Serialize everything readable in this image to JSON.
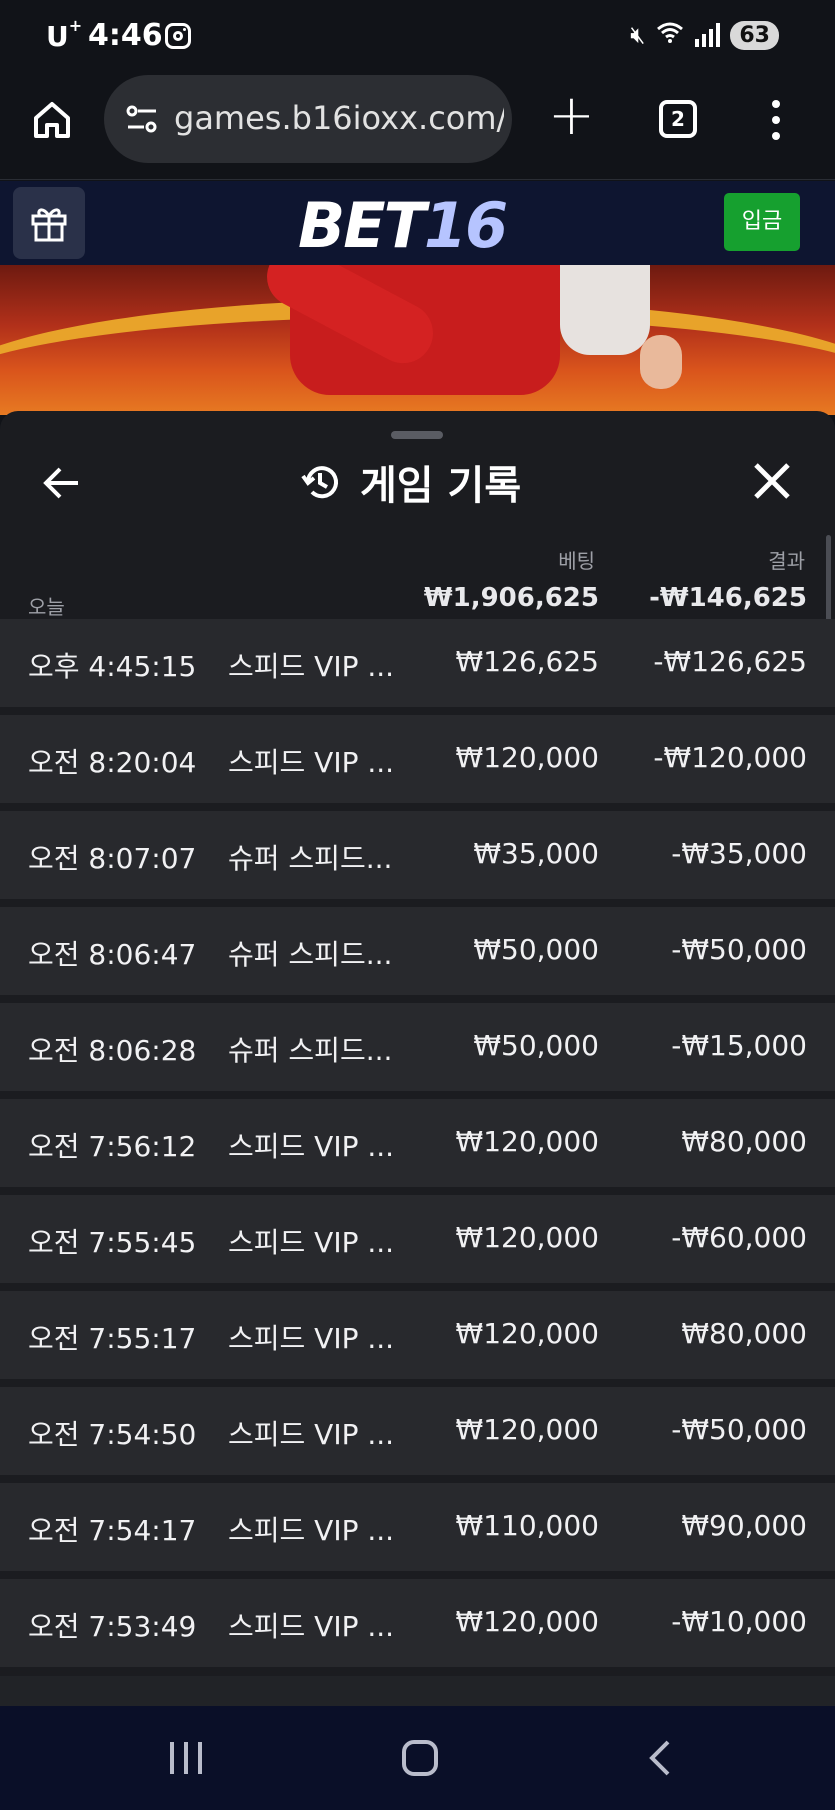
{
  "status_bar": {
    "carrier": "U",
    "carrier_sup": "+",
    "time": "4:46",
    "battery": "63"
  },
  "browser": {
    "url": "games.b16ioxx.com/",
    "tab_count": "2"
  },
  "site": {
    "logo_part1": "BET",
    "logo_part2": "16",
    "deposit_label": "입금"
  },
  "panel": {
    "title": "게임 기록",
    "col_bet": "베팅",
    "col_result": "결과",
    "today_label": "오늘",
    "total_bet": "₩1,906,625",
    "total_result": "-₩146,625"
  },
  "rows": [
    {
      "time": "오후 4:45:15",
      "game": "스피드 VIP ...",
      "bet": "₩126,625",
      "result": "-₩126,625"
    },
    {
      "time": "오전 8:20:04",
      "game": "스피드 VIP ...",
      "bet": "₩120,000",
      "result": "-₩120,000"
    },
    {
      "time": "오전 8:07:07",
      "game": "슈퍼 스피드...",
      "bet": "₩35,000",
      "result": "-₩35,000"
    },
    {
      "time": "오전 8:06:47",
      "game": "슈퍼 스피드...",
      "bet": "₩50,000",
      "result": "-₩50,000"
    },
    {
      "time": "오전 8:06:28",
      "game": "슈퍼 스피드...",
      "bet": "₩50,000",
      "result": "-₩15,000"
    },
    {
      "time": "오전 7:56:12",
      "game": "스피드 VIP ...",
      "bet": "₩120,000",
      "result": "₩80,000"
    },
    {
      "time": "오전 7:55:45",
      "game": "스피드 VIP ...",
      "bet": "₩120,000",
      "result": "-₩60,000"
    },
    {
      "time": "오전 7:55:17",
      "game": "스피드 VIP ...",
      "bet": "₩120,000",
      "result": "₩80,000"
    },
    {
      "time": "오전 7:54:50",
      "game": "스피드 VIP ...",
      "bet": "₩120,000",
      "result": "-₩50,000"
    },
    {
      "time": "오전 7:54:17",
      "game": "스피드 VIP ...",
      "bet": "₩110,000",
      "result": "₩90,000"
    },
    {
      "time": "오전 7:53:49",
      "game": "스피드 VIP ...",
      "bet": "₩120,000",
      "result": "-₩10,000"
    }
  ],
  "icons": {
    "home": "home-icon",
    "tune": "site-settings-icon",
    "gift": "gift-icon",
    "history": "history-icon",
    "back": "arrow-left-icon",
    "close": "close-icon"
  },
  "colors": {
    "deposit_button": "#16a02f",
    "site_header": "#0e1530",
    "panel_bg": "#1b1c20",
    "row_bg": "#28292d",
    "logo_accent": "#b6c4ff"
  }
}
